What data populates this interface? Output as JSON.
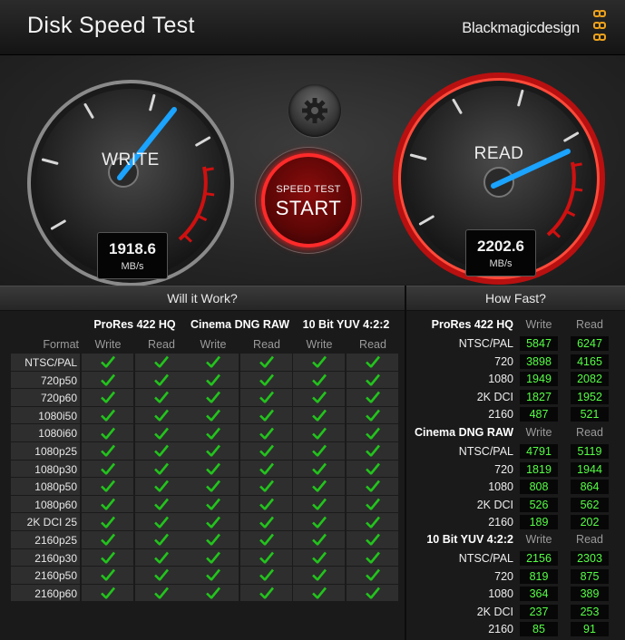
{
  "window": {
    "title": "Disk Speed Test",
    "brand": "Blackmagicdesign"
  },
  "gauges": {
    "write": {
      "label": "WRITE",
      "value": "1918.6",
      "unit": "MB/s"
    },
    "read": {
      "label": "READ",
      "value": "2202.6",
      "unit": "MB/s"
    }
  },
  "controls": {
    "settings_icon": "gear-icon",
    "start_small": "SPEED TEST",
    "start_big": "START"
  },
  "will_it_work": {
    "title": "Will it Work?",
    "format_label": "Format",
    "groups": [
      "ProRes 422 HQ",
      "Cinema DNG RAW",
      "10 Bit YUV 4:2:2"
    ],
    "subcols": [
      "Write",
      "Read"
    ],
    "formats": [
      "NTSC/PAL",
      "720p50",
      "720p60",
      "1080i50",
      "1080i60",
      "1080p25",
      "1080p30",
      "1080p50",
      "1080p60",
      "2K DCI 25",
      "2160p25",
      "2160p30",
      "2160p50",
      "2160p60"
    ],
    "check_icon": "checkmark-icon",
    "check_color": "#22c41c"
  },
  "how_fast": {
    "title": "How Fast?",
    "subcols": [
      "Write",
      "Read"
    ],
    "groups": [
      {
        "name": "ProRes 422 HQ",
        "rows": [
          {
            "label": "NTSC/PAL",
            "write": "5847",
            "read": "6247"
          },
          {
            "label": "720",
            "write": "3898",
            "read": "4165"
          },
          {
            "label": "1080",
            "write": "1949",
            "read": "2082"
          },
          {
            "label": "2K DCI",
            "write": "1827",
            "read": "1952"
          },
          {
            "label": "2160",
            "write": "487",
            "read": "521"
          }
        ]
      },
      {
        "name": "Cinema DNG RAW",
        "rows": [
          {
            "label": "NTSC/PAL",
            "write": "4791",
            "read": "5119"
          },
          {
            "label": "720",
            "write": "1819",
            "read": "1944"
          },
          {
            "label": "1080",
            "write": "808",
            "read": "864"
          },
          {
            "label": "2K DCI",
            "write": "526",
            "read": "562"
          },
          {
            "label": "2160",
            "write": "189",
            "read": "202"
          }
        ]
      },
      {
        "name": "10 Bit YUV 4:2:2",
        "rows": [
          {
            "label": "NTSC/PAL",
            "write": "2156",
            "read": "2303"
          },
          {
            "label": "720",
            "write": "819",
            "read": "875"
          },
          {
            "label": "1080",
            "write": "364",
            "read": "389"
          },
          {
            "label": "2K DCI",
            "write": "237",
            "read": "253"
          },
          {
            "label": "2160",
            "write": "85",
            "read": "91"
          }
        ]
      }
    ]
  },
  "colors": {
    "needle": "#1aa3ff",
    "read_ring": "#e01818",
    "redline": "#d01010",
    "value_text": "#55ff44"
  }
}
